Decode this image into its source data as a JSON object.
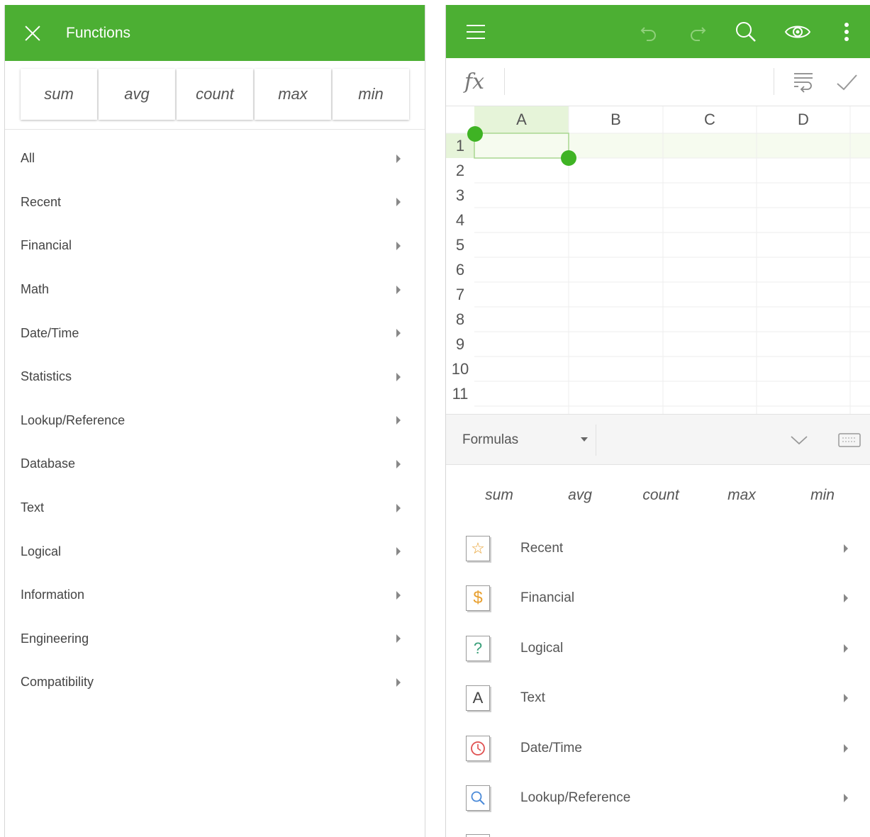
{
  "left_panel": {
    "header": {
      "title": "Functions",
      "close_icon": "close-icon"
    },
    "quick_functions": [
      "sum",
      "avg",
      "count",
      "max",
      "min"
    ],
    "categories": [
      "All",
      "Recent",
      "Financial",
      "Math",
      "Date/Time",
      "Statistics",
      "Lookup/Reference",
      "Database",
      "Text",
      "Logical",
      "Information",
      "Engineering",
      "Compatibility"
    ]
  },
  "right_panel": {
    "toolbar": {
      "menu_icon": "hamburger-menu-icon",
      "undo_icon": "undo-icon",
      "redo_icon": "redo-icon",
      "search_icon": "search-icon",
      "view_icon": "eye-icon",
      "more_icon": "more-vertical-icon"
    },
    "formula_bar": {
      "fx_label": "fx",
      "value": ""
    },
    "sheet": {
      "columns": [
        "A",
        "B",
        "C",
        "D"
      ],
      "rows": [
        "1",
        "2",
        "3",
        "4",
        "5",
        "6",
        "7",
        "8",
        "9",
        "10",
        "11"
      ],
      "selected_cell": "A1"
    },
    "formulas_panel": {
      "dropdown_label": "Formulas",
      "quick_functions": [
        "sum",
        "avg",
        "count",
        "max",
        "min"
      ],
      "categories": [
        {
          "label": "Recent",
          "icon": "star-icon",
          "symbol": "☆",
          "color": "#e8a030"
        },
        {
          "label": "Financial",
          "icon": "dollar-icon",
          "symbol": "$",
          "color": "#e8a030"
        },
        {
          "label": "Logical",
          "icon": "question-icon",
          "symbol": "?",
          "color": "#3aa07a"
        },
        {
          "label": "Text",
          "icon": "text-a-icon",
          "symbol": "A",
          "color": "#444444"
        },
        {
          "label": "Date/Time",
          "icon": "clock-icon",
          "symbol": "◷",
          "color": "#e05050"
        },
        {
          "label": "Lookup/Reference",
          "icon": "magnifier-icon",
          "symbol": "⚲",
          "color": "#4a8ad8"
        }
      ]
    }
  },
  "colors": {
    "accent_green": "#4caf33",
    "selected_cell_header": "#e6f4d9",
    "selection_handle": "#3fb324"
  }
}
